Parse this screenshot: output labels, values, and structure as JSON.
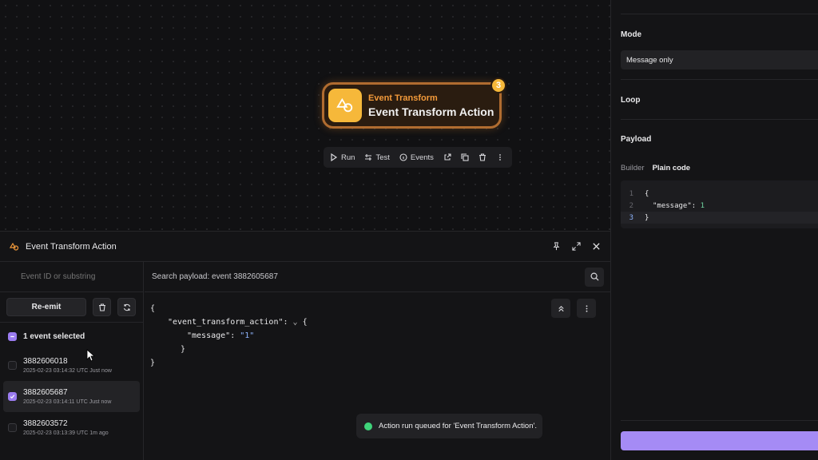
{
  "canvas": {
    "node": {
      "subtitle": "Event Transform",
      "title": "Event Transform Action",
      "badge": "3",
      "icon": "shapes-icon"
    },
    "toolbar": {
      "run": "Run",
      "test": "Test",
      "events": "Events"
    }
  },
  "panel": {
    "title": "Event Transform Action",
    "search": {
      "placeholder": "Event ID or substring"
    },
    "reemit_label": "Re-emit",
    "selected_text": "1 event selected",
    "events": [
      {
        "id": "3882606018",
        "meta": "2025-02-23 03:14:32 UTC Just now",
        "checked": false
      },
      {
        "id": "3882605687",
        "meta": "2025-02-23 03:14:11 UTC Just now",
        "checked": true
      },
      {
        "id": "3882603572",
        "meta": "2025-02-23 03:13:39 UTC 1m ago",
        "checked": false
      }
    ],
    "payload_search": "Search payload: event 3882605687",
    "json": {
      "open": "{",
      "key": "\"event_transform_action\"",
      "inner_open": "{",
      "msg_key": "\"message\"",
      "msg_val": "\"1\"",
      "inner_close": "}",
      "close": "}"
    }
  },
  "toast": {
    "text": "Action run queued for 'Event Transform Action'."
  },
  "sidebar": {
    "mode_label": "Mode",
    "mode_value": "Message only",
    "loop_label": "Loop",
    "payload_label": "Payload",
    "tab_builder": "Builder",
    "tab_plain": "Plain code",
    "code": {
      "l1": "1",
      "l2": "2",
      "l3": "3",
      "c1": "{",
      "c2_key": "\"message\"",
      "c2_val": "1",
      "c3": "}"
    }
  },
  "colors": {
    "accent": "#a58bf5",
    "node_border": "#b06c30",
    "node_icon_bg": "#f6b83a",
    "success": "#3fd47a"
  }
}
